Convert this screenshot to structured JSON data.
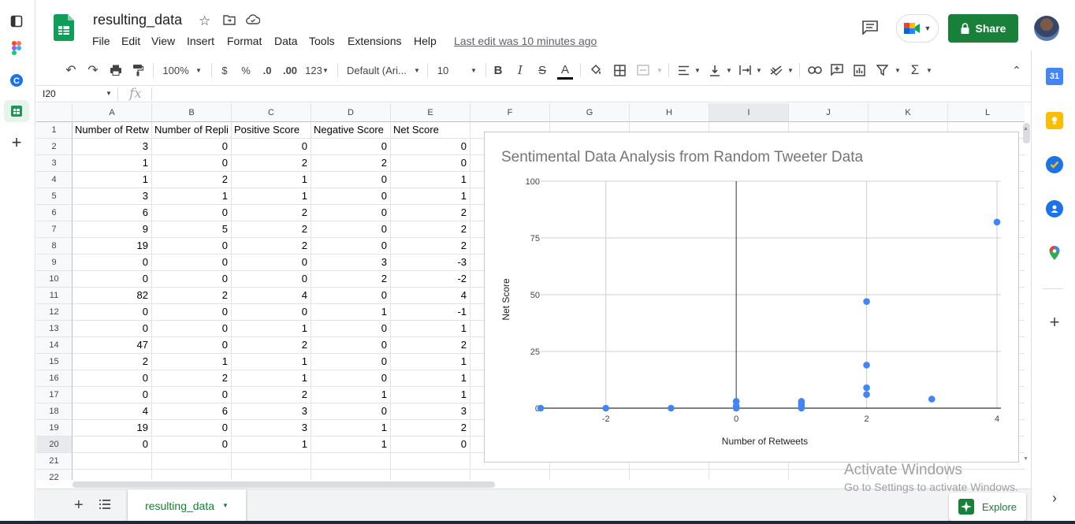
{
  "app": {
    "doc_title": "resulting_data",
    "menu": [
      "File",
      "Edit",
      "View",
      "Insert",
      "Format",
      "Data",
      "Tools",
      "Extensions",
      "Help"
    ],
    "last_edit": "Last edit was 10 minutes ago",
    "share_label": "Share"
  },
  "toolbar": {
    "zoom": "100%",
    "currency": "$",
    "percent": "%",
    "dec_decrease": ".0",
    "dec_increase": ".00",
    "more_formats": "123",
    "font": "Default (Ari...",
    "font_size": "10"
  },
  "formula_bar": {
    "name_box": "I20",
    "fx": "fx",
    "content": ""
  },
  "columns": [
    "A",
    "B",
    "C",
    "D",
    "E",
    "F",
    "G",
    "H",
    "I",
    "J",
    "K",
    "L"
  ],
  "rows": [
    "1",
    "2",
    "3",
    "4",
    "5",
    "6",
    "7",
    "8",
    "9",
    "10",
    "11",
    "12",
    "13",
    "14",
    "15",
    "16",
    "17",
    "18",
    "19",
    "20",
    "21",
    "22"
  ],
  "headers": [
    "Number of Retw",
    "Number of Repli",
    "Positive Score",
    "Negative Score",
    "Net Score"
  ],
  "table": [
    [
      "3",
      "0",
      "0",
      "0",
      "0"
    ],
    [
      "1",
      "0",
      "2",
      "2",
      "0"
    ],
    [
      "1",
      "2",
      "1",
      "0",
      "1"
    ],
    [
      "3",
      "1",
      "1",
      "0",
      "1"
    ],
    [
      "6",
      "0",
      "2",
      "0",
      "2"
    ],
    [
      "9",
      "5",
      "2",
      "0",
      "2"
    ],
    [
      "19",
      "0",
      "2",
      "0",
      "2"
    ],
    [
      "0",
      "0",
      "0",
      "3",
      "-3"
    ],
    [
      "0",
      "0",
      "0",
      "2",
      "-2"
    ],
    [
      "82",
      "2",
      "4",
      "0",
      "4"
    ],
    [
      "0",
      "0",
      "0",
      "1",
      "-1"
    ],
    [
      "0",
      "0",
      "1",
      "0",
      "1"
    ],
    [
      "47",
      "0",
      "2",
      "0",
      "2"
    ],
    [
      "2",
      "1",
      "1",
      "0",
      "1"
    ],
    [
      "0",
      "2",
      "1",
      "0",
      "1"
    ],
    [
      "0",
      "0",
      "2",
      "1",
      "1"
    ],
    [
      "4",
      "6",
      "3",
      "0",
      "3"
    ],
    [
      "19",
      "0",
      "3",
      "1",
      "2"
    ],
    [
      "0",
      "0",
      "1",
      "1",
      "0"
    ]
  ],
  "chart_data": {
    "type": "scatter",
    "title": "Sentimental Data Analysis from Random Tweeter Data",
    "xlabel": "Number of Retweets",
    "ylabel": "Net Score",
    "xlim": [
      -3,
      4
    ],
    "ylim": [
      0,
      100
    ],
    "x_ticks": [
      "-2",
      "0",
      "2",
      "4"
    ],
    "y_ticks": [
      "0",
      "25",
      "50",
      "75",
      "100"
    ],
    "grid": true,
    "color": "#4285f4",
    "points": [
      {
        "x": -3,
        "y": 0
      },
      {
        "x": -2,
        "y": 0
      },
      {
        "x": -1,
        "y": 0
      },
      {
        "x": 0,
        "y": 3
      },
      {
        "x": 0,
        "y": 1
      },
      {
        "x": 0,
        "y": 0
      },
      {
        "x": 1,
        "y": 3
      },
      {
        "x": 1,
        "y": 1
      },
      {
        "x": 1,
        "y": 2
      },
      {
        "x": 1,
        "y": 0
      },
      {
        "x": 2,
        "y": 47
      },
      {
        "x": 2,
        "y": 19
      },
      {
        "x": 2,
        "y": 9
      },
      {
        "x": 2,
        "y": 6
      },
      {
        "x": 3,
        "y": 4
      },
      {
        "x": 4,
        "y": 82
      }
    ]
  },
  "tabs": {
    "sheet_name": "resulting_data",
    "explore_label": "Explore"
  },
  "watermark": {
    "line1": "Activate Windows",
    "line2": "Go to Settings to activate Windows."
  },
  "colors": {
    "brand_green": "#188038",
    "accent_blue": "#4285f4"
  }
}
